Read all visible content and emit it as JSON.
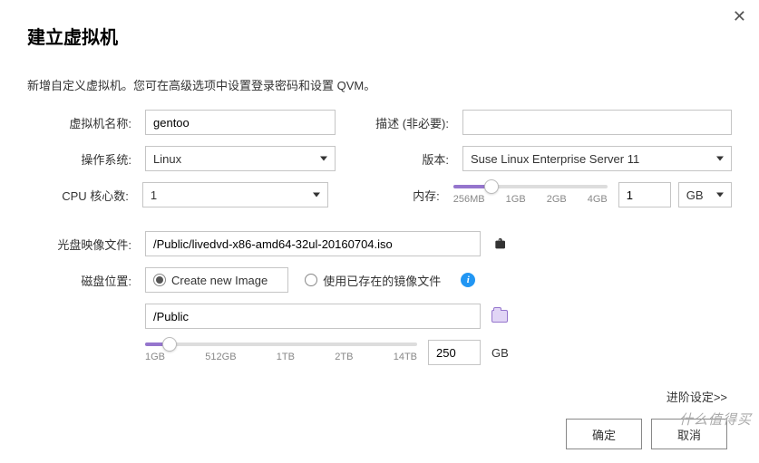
{
  "title": "建立虚拟机",
  "subtitle": "新增自定义虚拟机。您可在高级选项中设置登录密码和设置 QVM。",
  "labels": {
    "vm_name": "虚拟机名称:",
    "description": "描述 (非必要):",
    "os": "操作系统:",
    "version": "版本:",
    "cpu_cores": "CPU 核心数:",
    "memory": "内存:",
    "cd_image": "光盘映像文件:",
    "disk_location": "磁盘位置:",
    "disk_size_unit": "GB"
  },
  "values": {
    "vm_name": "gentoo",
    "description": "",
    "os": "Linux",
    "version": "Suse Linux Enterprise Server 11",
    "cpu_cores": "1",
    "memory_value": "1",
    "memory_unit": "GB",
    "cd_image_path": "/Public/livedvd-x86-amd64-32ul-20160704.iso",
    "disk_path": "/Public",
    "disk_size": "250"
  },
  "memory_slider": {
    "fill_pct": 25,
    "ticks": [
      "256MB",
      "1GB",
      "2GB",
      "4GB"
    ]
  },
  "disk_radio": {
    "create_new": "Create new Image",
    "use_existing": "使用已存在的镜像文件"
  },
  "disk_slider": {
    "fill_pct": 9,
    "ticks": [
      "1GB",
      "512GB",
      "1TB",
      "2TB",
      "14TB"
    ]
  },
  "adv_link": "进阶设定>>",
  "buttons": {
    "ok": "确定",
    "cancel": "取消"
  },
  "watermark": "什么值得买"
}
